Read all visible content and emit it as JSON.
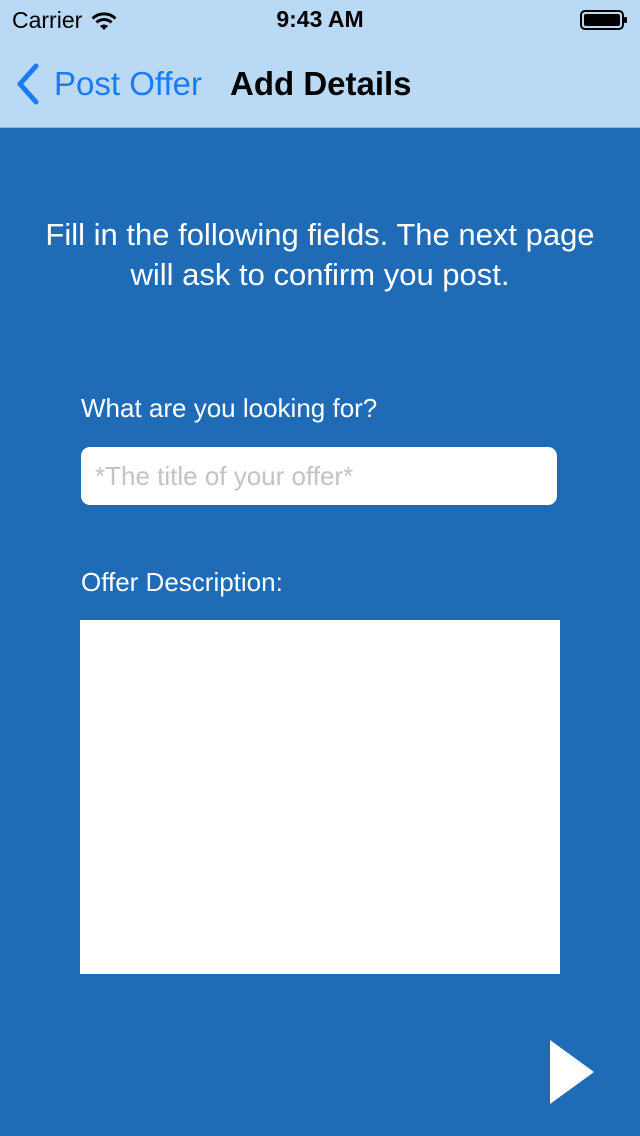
{
  "status_bar": {
    "carrier": "Carrier",
    "time": "9:43 AM"
  },
  "nav": {
    "back_label": "Post Offer",
    "title": "Add Details"
  },
  "form": {
    "instructions": "Fill in the following fields. The next page will ask to confirm you post.",
    "title_label": "What are you looking for?",
    "title_placeholder": "*The title of your offer*",
    "title_value": "",
    "description_label": "Offer Description:",
    "description_value": ""
  },
  "icons": {
    "wifi": "wifi-icon",
    "battery": "battery-icon",
    "back": "chevron-left-icon",
    "next": "play-arrow-icon"
  },
  "colors": {
    "background": "#206BB5",
    "nav_background": "#BAD9F4",
    "accent": "#1A7CF5"
  }
}
